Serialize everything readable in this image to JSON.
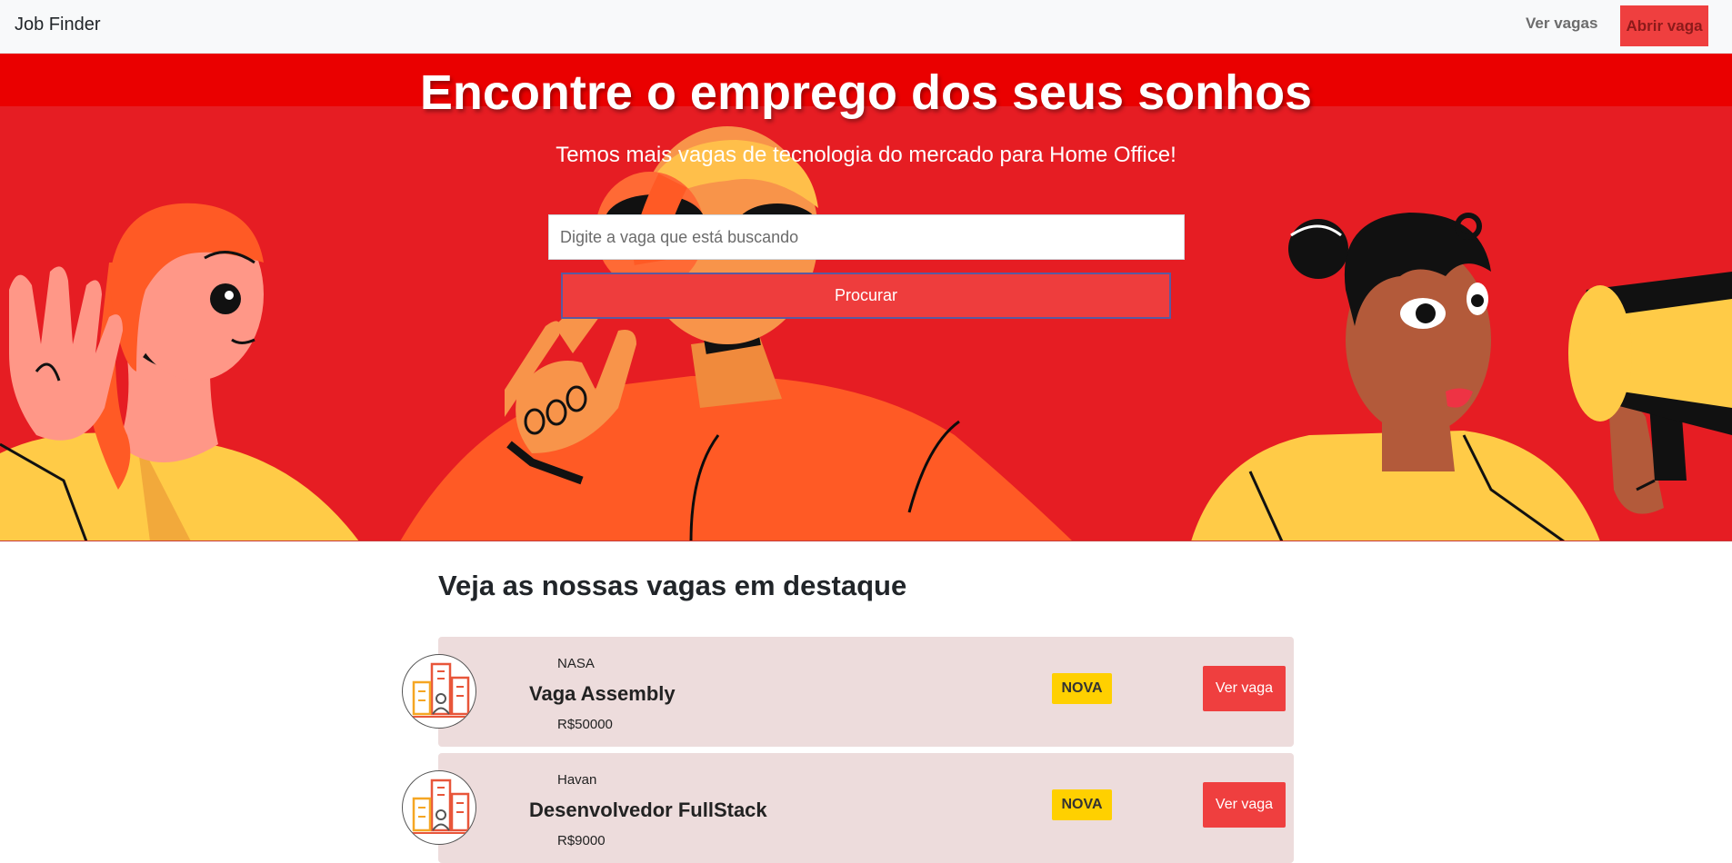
{
  "navbar": {
    "brand": "Job Finder",
    "links": [
      {
        "label": "Ver vagas"
      },
      {
        "label": "Abrir vaga"
      }
    ]
  },
  "hero": {
    "title": "Encontre o emprego dos seus sonhos",
    "subtitle": "Temos mais vagas de tecnologia do mercado para Home Office!",
    "search": {
      "placeholder": "Digite a vaga que está buscando",
      "value": ""
    },
    "search_button": "Procurar"
  },
  "featured": {
    "title": "Veja as nossas vagas em destaque",
    "jobs": [
      {
        "company": "NASA",
        "title": "Vaga Assembly",
        "salary": "R$50000",
        "badge": "NOVA",
        "button": "Ver vaga",
        "logo_icon": "company-building-icon"
      },
      {
        "company": "Havan",
        "title": "Desenvolvedor FullStack",
        "salary": "R$9000",
        "badge": "NOVA",
        "button": "Ver vaga",
        "logo_icon": "company-building-icon"
      }
    ]
  },
  "colors": {
    "hero_bg": "#e61d23",
    "accent": "#ef3f3f",
    "badge": "#ffd000",
    "card_bg": "#eddcdc"
  }
}
